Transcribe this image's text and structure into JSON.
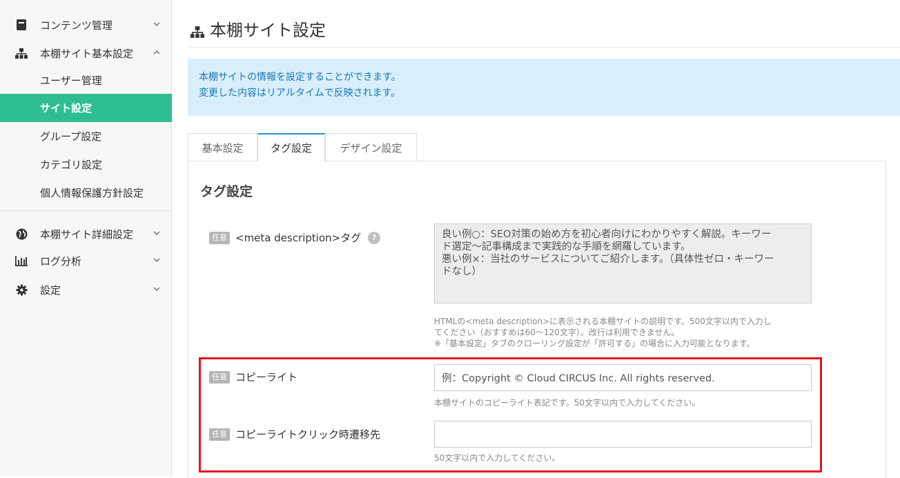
{
  "sidebar": {
    "items": [
      {
        "label": "コンテンツ管理"
      },
      {
        "label": "本棚サイト基本設定"
      },
      {
        "label": "ユーザー管理"
      },
      {
        "label": "サイト設定"
      },
      {
        "label": "グループ設定"
      },
      {
        "label": "カテゴリ設定"
      },
      {
        "label": "個人情報保護方針設定"
      },
      {
        "label": "本棚サイト詳細設定"
      },
      {
        "label": "ログ分析"
      },
      {
        "label": "設定"
      }
    ]
  },
  "header": {
    "title": "本棚サイト設定"
  },
  "info": {
    "line1": "本棚サイトの情報を設定することができます。",
    "line2": "変更した内容はリアルタイムで反映されます。"
  },
  "tabs": [
    {
      "label": "基本設定"
    },
    {
      "label": "タグ設定"
    },
    {
      "label": "デザイン設定"
    }
  ],
  "section": {
    "title": "タグ設定"
  },
  "fields": {
    "badge": "任意",
    "meta": {
      "label": "<meta description>タグ",
      "help": "?",
      "value_l1": "良い例○：SEO対策の始め方を初心者向けにわかりやすく解説。キーワー",
      "value_l2": "ド選定～記事構成まで実践的な手順を網羅しています。",
      "value_l3": "悪い例×：当社のサービスについてご紹介します。（具体性ゼロ・キーワー",
      "value_l4": "ドなし）",
      "hint_l1": "HTMLの<meta description>に表示される本棚サイトの説明です。500文字以内で入力し",
      "hint_l2": "てください（おすすめは60〜120文字）。改行は利用できません。",
      "hint_l3": "※「基本設定」タブのクローリング設定が「許可する」の場合に入力可能となります。"
    },
    "copyright": {
      "label": "コピーライト",
      "placeholder": "例：Copyright © Cloud CIRCUS Inc. All rights reserved.",
      "hint": "本棚サイトのコピーライト表記です。50文字以内で入力してください。"
    },
    "copyright_link": {
      "label": "コピーライトクリック時遷移先",
      "value": "",
      "hint": "50文字以内で入力してください。"
    }
  },
  "colors": {
    "accent": "#2fbe94",
    "info_bg": "#d8eefb",
    "highlight": "#e4141b"
  }
}
